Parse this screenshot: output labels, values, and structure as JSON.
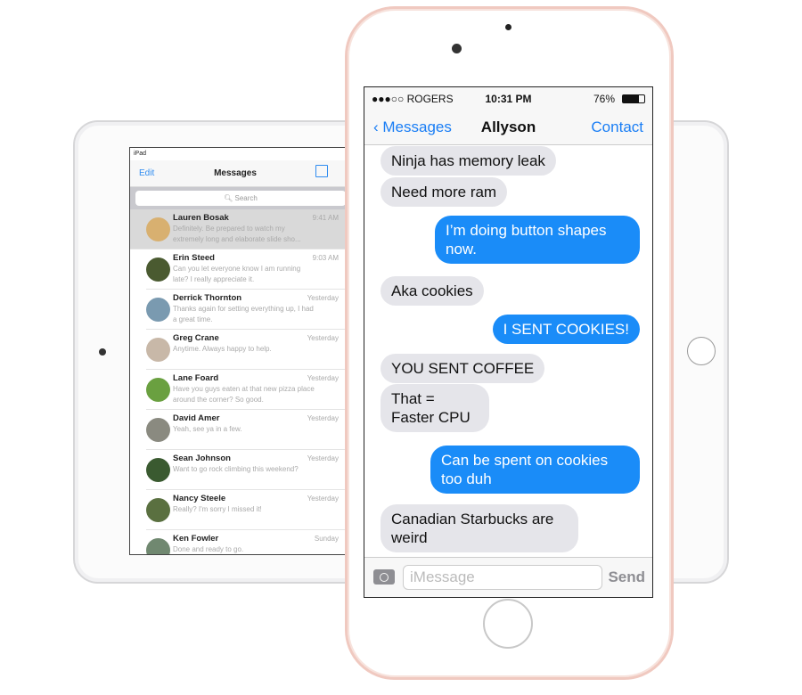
{
  "ipad": {
    "status": "iPad",
    "nav": {
      "edit": "Edit",
      "title": "Messages"
    },
    "search_placeholder": "Search",
    "conversations": [
      {
        "name": "Lauren Bosak",
        "time": "9:41 AM",
        "preview": "Definitely. Be prepared to watch my extremely long and elaborate slide sho...",
        "selected": true,
        "avatar_color": "#d8b070"
      },
      {
        "name": "Erin Steed",
        "time": "9:03 AM",
        "preview": "Can you let everyone know I am running late? I really appreciate it.",
        "avatar_color": "#4a5a30"
      },
      {
        "name": "Derrick Thornton",
        "time": "Yesterday",
        "preview": "Thanks again for setting everything up, I had a great time.",
        "avatar_color": "#7a9ab0"
      },
      {
        "name": "Greg Crane",
        "time": "Yesterday",
        "preview": "Anytime. Always happy to help.",
        "avatar_color": "#c8b8a8"
      },
      {
        "name": "Lane Foard",
        "time": "Yesterday",
        "preview": "Have you guys eaten at that new pizza place around the corner? So good.",
        "avatar_color": "#6aa040"
      },
      {
        "name": "David Amer",
        "time": "Yesterday",
        "preview": "Yeah, see ya in a few.",
        "avatar_color": "#8a8a80"
      },
      {
        "name": "Sean Johnson",
        "time": "Yesterday",
        "preview": "Want to go rock climbing this weekend?",
        "avatar_color": "#3a5a30"
      },
      {
        "name": "Nancy Steele",
        "time": "Yesterday",
        "preview": "Really? I'm sorry I missed it!",
        "avatar_color": "#5a7040"
      },
      {
        "name": "Ken Fowler",
        "time": "Sunday",
        "preview": "Done and ready to go.",
        "avatar_color": "#708870"
      }
    ]
  },
  "iphone": {
    "status": {
      "carrier": "●●●○○ ROGERS",
      "time": "10:31 PM",
      "battery": "76%"
    },
    "nav": {
      "back": "Messages",
      "title": "Allyson",
      "contact": "Contact"
    },
    "messages": [
      {
        "dir": "in",
        "text": "Ninja has memory leak"
      },
      {
        "dir": "in",
        "text": "Need more ram"
      },
      {
        "dir": "out",
        "text": "I’m doing button shapes now."
      },
      {
        "dir": "in",
        "text": "Aka cookies"
      },
      {
        "dir": "out",
        "text": "I SENT COOKIES!"
      },
      {
        "dir": "in",
        "text": "YOU SENT COFFEE"
      },
      {
        "dir": "in",
        "text": "That = Faster CPU"
      },
      {
        "dir": "out",
        "text": "Can be spent on cookies too duh"
      },
      {
        "dir": "in",
        "text": "Canadian Starbucks are weird"
      }
    ],
    "input_placeholder": "iMessage",
    "send": "Send"
  },
  "colors": {
    "accent": "#1a7ef5",
    "outgoing": "#1a8cf8",
    "incoming": "#e5e5ea",
    "phone_frame": "#f0c9c0"
  }
}
